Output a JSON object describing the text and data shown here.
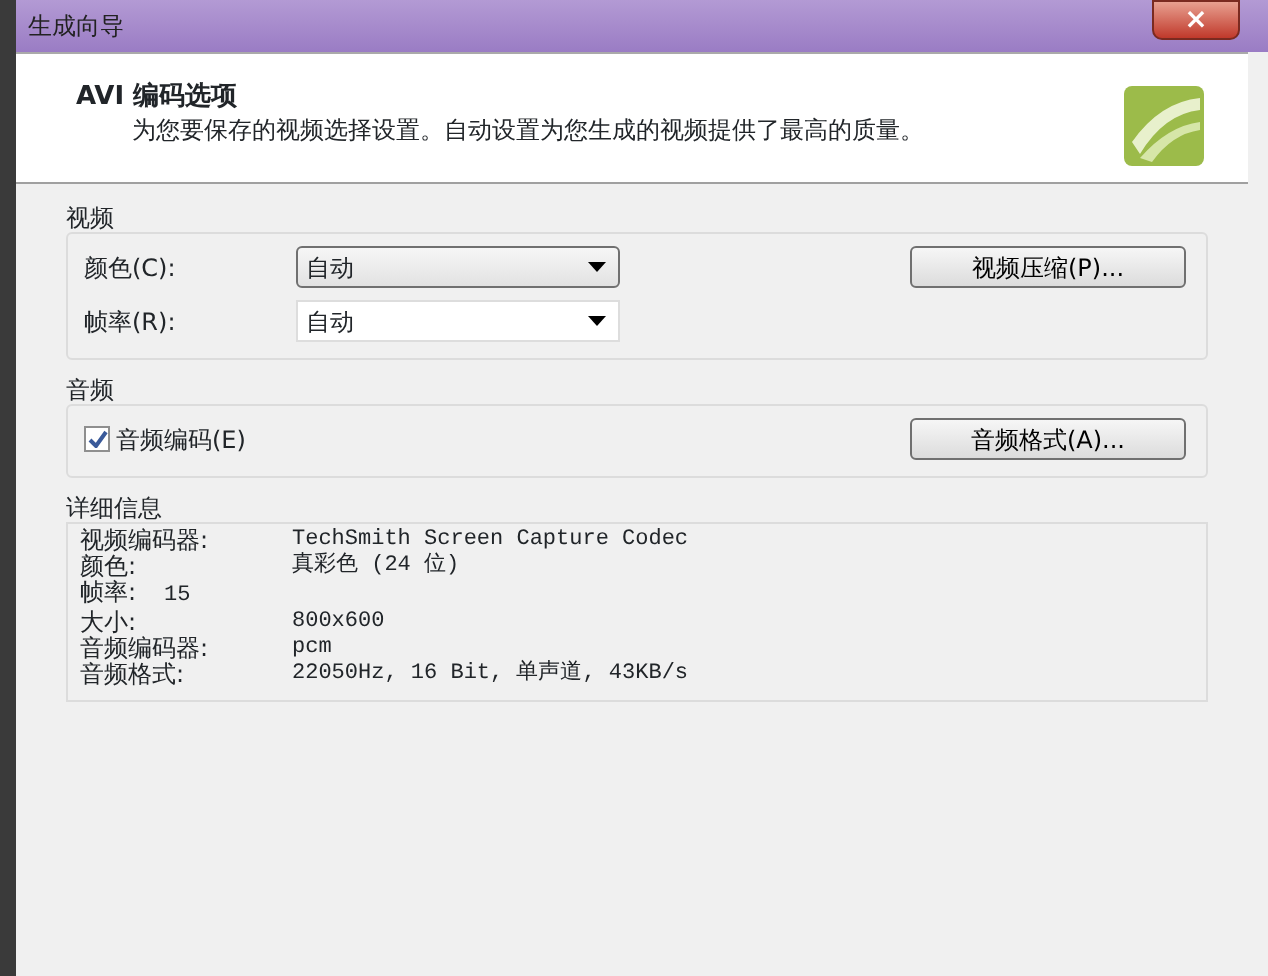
{
  "window": {
    "title": "生成向导",
    "close": "×"
  },
  "header": {
    "title": "AVI 编码选项",
    "subtitle": "为您要保存的视频选择设置。自动设置为您生成的视频提供了最高的质量。"
  },
  "video": {
    "legend": "视频",
    "fields": [
      {
        "label": "颜色(C):",
        "value": "自动",
        "focused": true
      },
      {
        "label": "帧率(R):",
        "value": "自动",
        "focused": false
      }
    ],
    "button": "视频压缩(P)..."
  },
  "audio": {
    "legend": "音频",
    "checkbox": {
      "label": "音频编码(E)",
      "checked": true
    },
    "button": "音频格式(A)..."
  },
  "details": {
    "legend": "详细信息",
    "rows": [
      {
        "kind": "column",
        "label": "视频编码器:",
        "value": "TechSmith Screen Capture Codec"
      },
      {
        "kind": "column",
        "label": "颜色:",
        "value": "真彩色 (24 位)"
      },
      {
        "kind": "inline",
        "label": "帧率:",
        "value": "15"
      },
      {
        "kind": "column",
        "label": "大小:",
        "value": "800x600"
      },
      {
        "kind": "column",
        "label": "音频编码器:",
        "value": "pcm"
      },
      {
        "kind": "column",
        "label": "音频格式:",
        "value": "22050Hz, 16 Bit, 单声道, 43KB/s"
      }
    ]
  }
}
